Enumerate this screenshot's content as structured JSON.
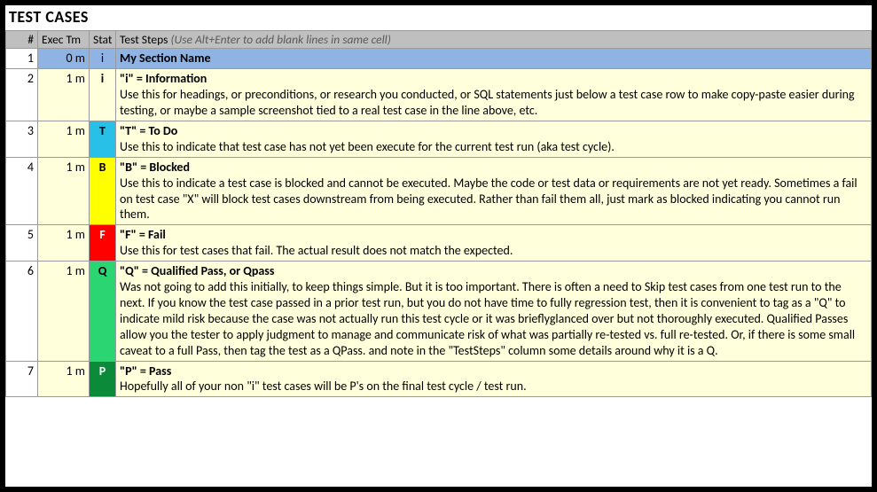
{
  "title": "TEST CASES",
  "headers": {
    "num": "#",
    "exec": "Exec Tm",
    "stat": "Stat",
    "steps": "Test Steps",
    "steps_hint": " (Use Alt+Enter to add blank lines in same cell)"
  },
  "rows": [
    {
      "num": "1",
      "exec": "0 m",
      "stat": "i",
      "stat_class": "stat-i",
      "section": true,
      "heading": "My Section Name",
      "body": ""
    },
    {
      "num": "2",
      "exec": "1 m",
      "stat": "i",
      "stat_class": "stat-i",
      "heading": "\"i\" = Information",
      "body": "Use this for headings, or preconditions, or research you conducted, or SQL statements just below a test case row to make copy-paste easier during testing, or maybe a sample screenshot tied to a real test case in the line above, etc."
    },
    {
      "num": "3",
      "exec": "1 m",
      "stat": "T",
      "stat_class": "stat-T",
      "heading": "\"T\" = To Do",
      "body": "Use this to indicate that test case has not yet been execute for the current test run (aka test cycle)."
    },
    {
      "num": "4",
      "exec": "1 m",
      "stat": "B",
      "stat_class": "stat-B",
      "heading": "\"B\" = Blocked",
      "body": "Use this to indicate a test case is blocked and cannot be executed.  Maybe the code or test data or requirements are not yet ready. Sometimes a fail on test case \"X\" will block test cases downstream from being executed.  Rather than fail them all, just mark as blocked indicating you cannot run them."
    },
    {
      "num": "5",
      "exec": "1 m",
      "stat": "F",
      "stat_class": "stat-F",
      "heading": "\"F\" = Fail",
      "body": "Use this for test cases that fail.  The actual result does not match the expected."
    },
    {
      "num": "6",
      "exec": "1 m",
      "stat": "Q",
      "stat_class": "stat-Q",
      "heading": "\"Q\" = Qualified Pass, or Qpass",
      "body": "Was not going to add this initially, to keep things simple.  But it is too important.  There is often a need to Skip test cases from one test run to the next.  If you know the test case passed in a prior test run, but you do not have time to fully regression test, then it is convenient to tag as a \"Q\" to indicate mild risk because the case was not actually run this test cycle or it was brieflyglanced over but not thoroughly executed.  Qualified Passes allow you the tester to apply judgment to manage and communicate risk of what was partially re-tested vs. full re-tested.  Or, if there is some small caveat to a full Pass, then tag the test as a QPass. and note in the \"TestSteps\" column some details around why it is a Q."
    },
    {
      "num": "7",
      "exec": "1 m",
      "stat": "P",
      "stat_class": "stat-P",
      "heading": "\"P\" = Pass",
      "body": "Hopefully all of your non \"i\" test cases will be P's on the final test cycle / test run."
    }
  ]
}
